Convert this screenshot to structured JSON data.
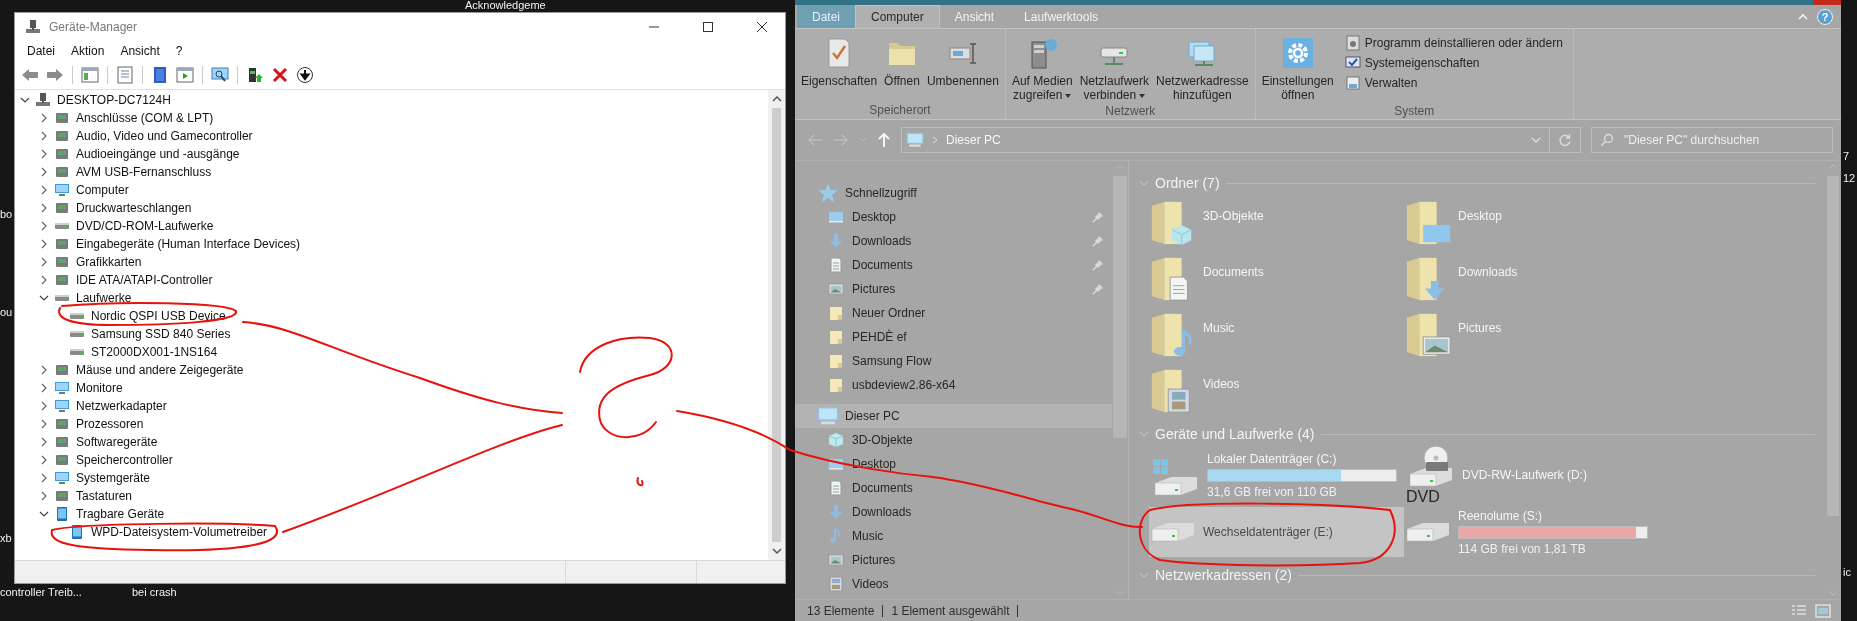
{
  "desktop": {
    "labels": [
      "Acknowledgeme",
      "bo",
      "ou",
      "xb",
      "controller Treib...",
      "bei crash",
      "7",
      "12",
      "ic"
    ]
  },
  "device_manager": {
    "title": "Geräte-Manager",
    "menu": [
      "Datei",
      "Aktion",
      "Ansicht",
      "?"
    ],
    "toolbar": [
      [
        {
          "kind": "back"
        },
        {
          "kind": "forward"
        }
      ],
      [
        {
          "kind": "tree"
        }
      ],
      [
        {
          "kind": "properties"
        }
      ],
      [
        {
          "kind": "help"
        },
        {
          "kind": "action"
        }
      ],
      [
        {
          "kind": "scan"
        }
      ],
      [
        {
          "kind": "update"
        },
        {
          "kind": "uninstall"
        },
        {
          "kind": "disable"
        }
      ]
    ],
    "tree": {
      "label": "DESKTOP-DC7124H",
      "kind": "computer",
      "expanded": true,
      "children": [
        {
          "label": "Anschlüsse (COM & LPT)",
          "kind": "category",
          "expanded": false
        },
        {
          "label": "Audio, Video und Gamecontroller",
          "kind": "category",
          "expanded": false
        },
        {
          "label": "Audioeingänge und -ausgänge",
          "kind": "category",
          "expanded": false
        },
        {
          "label": "AVM USB-Fernanschluss",
          "kind": "category",
          "expanded": false
        },
        {
          "label": "Computer",
          "kind": "monitor",
          "expanded": false
        },
        {
          "label": "Druckwarteschlangen",
          "kind": "category",
          "expanded": false
        },
        {
          "label": "DVD/CD-ROM-Laufwerke",
          "kind": "drive",
          "expanded": false
        },
        {
          "label": "Eingabegeräte (Human Interface Devices)",
          "kind": "category",
          "expanded": false
        },
        {
          "label": "Grafikkarten",
          "kind": "category",
          "expanded": false
        },
        {
          "label": "IDE ATA/ATAPI-Controller",
          "kind": "category",
          "expanded": false
        },
        {
          "label": "Laufwerke",
          "kind": "drive",
          "expanded": true,
          "children": [
            {
              "label": "Nordic QSPI USB Device",
              "kind": "drive"
            },
            {
              "label": "Samsung SSD 840 Series",
              "kind": "drive"
            },
            {
              "label": "ST2000DX001-1NS164",
              "kind": "drive"
            }
          ]
        },
        {
          "label": "Mäuse und andere Zeigegeräte",
          "kind": "category",
          "expanded": false
        },
        {
          "label": "Monitore",
          "kind": "monitor",
          "expanded": false
        },
        {
          "label": "Netzwerkadapter",
          "kind": "monitor",
          "expanded": false
        },
        {
          "label": "Prozessoren",
          "kind": "category",
          "expanded": false
        },
        {
          "label": "Softwaregeräte",
          "kind": "category",
          "expanded": false
        },
        {
          "label": "Speichercontroller",
          "kind": "category",
          "expanded": false
        },
        {
          "label": "Systemgeräte",
          "kind": "monitor",
          "expanded": false
        },
        {
          "label": "Tastaturen",
          "kind": "category",
          "expanded": false
        },
        {
          "label": "Tragbare Geräte",
          "kind": "portable",
          "expanded": true,
          "children": [
            {
              "label": "WPD-Dateisystem-Volumetreiber",
              "kind": "portable"
            }
          ]
        }
      ]
    }
  },
  "explorer": {
    "tabs": [
      {
        "label": "Datei",
        "kind": "file",
        "selected": false
      },
      {
        "label": "Computer",
        "kind": "tab",
        "selected": true
      },
      {
        "label": "Ansicht",
        "kind": "tab",
        "selected": false
      },
      {
        "label": "Laufwerktools",
        "kind": "tab",
        "selected": false
      }
    ],
    "help_button": "?",
    "ribbon_groups": [
      {
        "label": "Speicherort",
        "buttons": [
          {
            "label": "Eigenschaften",
            "kind": "properties",
            "dropdown": false
          },
          {
            "label": "Öffnen",
            "kind": "open",
            "dropdown": false
          },
          {
            "label": "Umbenennen",
            "kind": "rename",
            "dropdown": false
          }
        ]
      },
      {
        "label": "Netzwerk",
        "buttons": [
          {
            "label": "Auf Medien\nzugreifen",
            "kind": "media",
            "dropdown": true
          },
          {
            "label": "Netzlaufwerk\nverbinden",
            "kind": "netdrive",
            "dropdown": true
          },
          {
            "label": "Netzwerkadresse\nhinzufügen",
            "kind": "netlocation",
            "dropdown": false
          }
        ]
      },
      {
        "label": "System",
        "buttons": [
          {
            "label": "Einstellungen\nöffnen",
            "kind": "settings",
            "dropdown": false
          }
        ],
        "small_buttons": [
          {
            "label": "Programm deinstallieren oder ändern",
            "kind": "uninstall"
          },
          {
            "label": "Systemeigenschaften",
            "kind": "sysprops"
          },
          {
            "label": "Verwalten",
            "kind": "manage"
          }
        ]
      }
    ],
    "address": {
      "path": "Dieser PC"
    },
    "search": {
      "placeholder": "\"Dieser PC\" durchsuchen"
    },
    "nav": [
      {
        "label": "Schnellzugriff",
        "kind": "star",
        "selected": false,
        "children": [
          {
            "label": "Desktop",
            "kind": "desktop",
            "pinned": true
          },
          {
            "label": "Downloads",
            "kind": "downloads",
            "pinned": true
          },
          {
            "label": "Documents",
            "kind": "documents",
            "pinned": true
          },
          {
            "label": "Pictures",
            "kind": "pictures",
            "pinned": true
          },
          {
            "label": "Neuer Ordner",
            "kind": "folder",
            "pinned": false
          },
          {
            "label": "PEHDÈ ef",
            "kind": "folder",
            "pinned": false
          },
          {
            "label": "Samsung Flow",
            "kind": "folder",
            "pinned": false
          },
          {
            "label": "usbdeview2.86-x64",
            "kind": "folder",
            "pinned": false
          }
        ]
      },
      {
        "label": "Dieser PC",
        "kind": "pc",
        "selected": true,
        "children": [
          {
            "label": "3D-Objekte",
            "kind": "objects3d",
            "pinned": false
          },
          {
            "label": "Desktop",
            "kind": "desktop",
            "pinned": false
          },
          {
            "label": "Documents",
            "kind": "documents",
            "pinned": false
          },
          {
            "label": "Downloads",
            "kind": "downloads",
            "pinned": false
          },
          {
            "label": "Music",
            "kind": "music",
            "pinned": false
          },
          {
            "label": "Pictures",
            "kind": "pictures",
            "pinned": false
          },
          {
            "label": "Videos",
            "kind": "videos",
            "pinned": false
          }
        ]
      }
    ],
    "sections": [
      {
        "title": "Ordner (7)",
        "kind": "folders",
        "items": [
          {
            "label": "3D-Objekte",
            "kind": "objects3d"
          },
          {
            "label": "Desktop",
            "kind": "desktop"
          },
          {
            "label": "Documents",
            "kind": "documents"
          },
          {
            "label": "Downloads",
            "kind": "downloads"
          },
          {
            "label": "Music",
            "kind": "music"
          },
          {
            "label": "Pictures",
            "kind": "pictures"
          },
          {
            "label": "Videos",
            "kind": "videos"
          }
        ]
      },
      {
        "title": "Geräte und Laufwerke (4)",
        "kind": "drives",
        "items": [
          {
            "label": "Lokaler Datenträger (C:)",
            "kind": "system",
            "selected": false,
            "level": 0.71,
            "color": "#a6d8ef",
            "free": "31,6 GB frei von 110 GB"
          },
          {
            "label": "DVD-RW-Laufwerk (D:)",
            "kind": "dvd",
            "selected": false,
            "disc_label": "DVD"
          },
          {
            "label": "Wechseldatenträger (E:)",
            "kind": "disk",
            "selected": true
          },
          {
            "label": "Reenolume (S:)",
            "kind": "disk",
            "selected": false,
            "level": 0.94,
            "color": "#eba7a7",
            "free": "114 GB frei von 1,81 TB"
          }
        ]
      },
      {
        "title": "Netzwerkadressen (2)",
        "kind": "network"
      }
    ],
    "status": [
      "13 Elemente",
      "1 Element ausgewählt"
    ]
  }
}
